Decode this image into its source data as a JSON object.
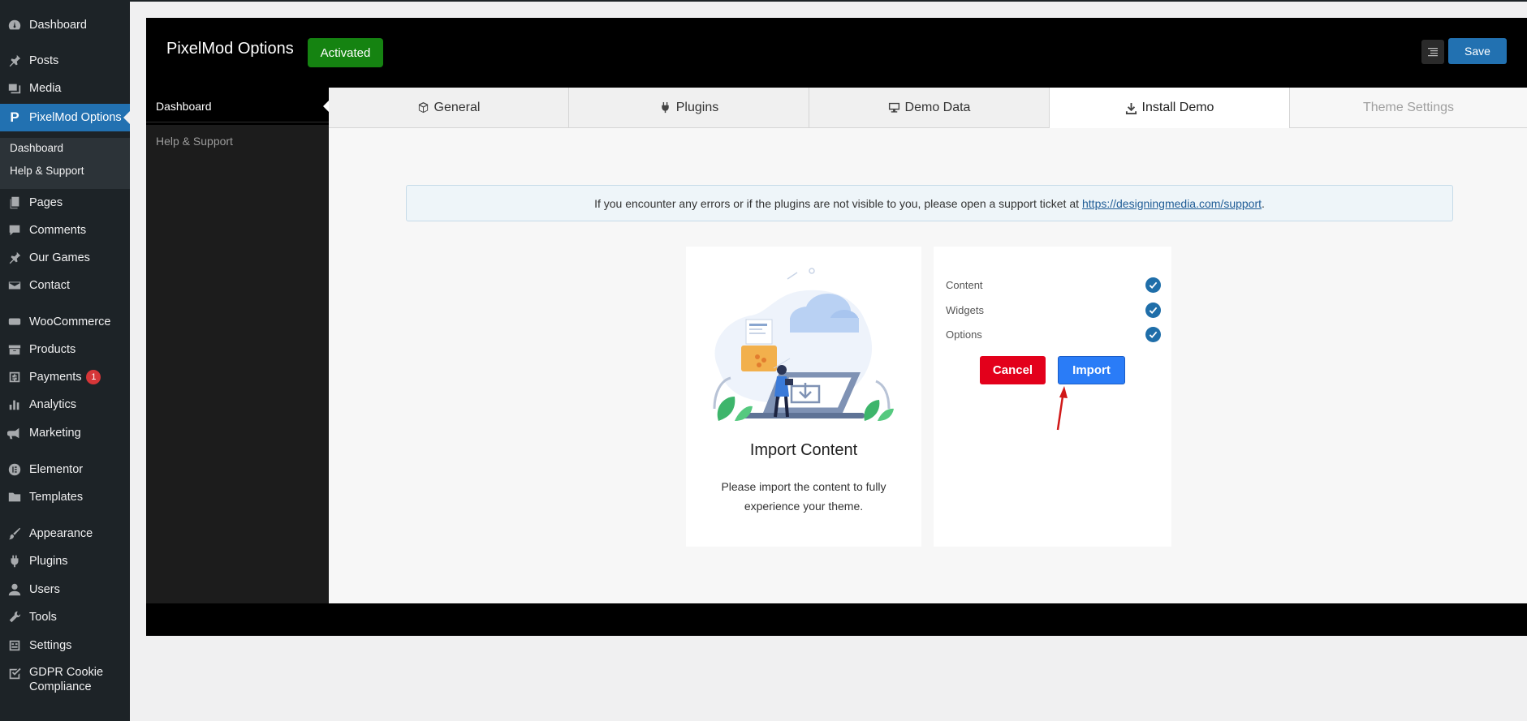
{
  "wp_menu": {
    "dashboard": "Dashboard",
    "posts": "Posts",
    "media": "Media",
    "pixelmod": "PixelMod Options",
    "sub_dashboard": "Dashboard",
    "sub_help": "Help & Support",
    "pages": "Pages",
    "comments": "Comments",
    "our_games": "Our Games",
    "contact": "Contact",
    "woocommerce": "WooCommerce",
    "products": "Products",
    "payments": "Payments",
    "payments_badge": "1",
    "analytics": "Analytics",
    "marketing": "Marketing",
    "elementor": "Elementor",
    "templates": "Templates",
    "appearance": "Appearance",
    "plugins": "Plugins",
    "users": "Users",
    "tools": "Tools",
    "settings": "Settings",
    "gdpr_line1": "GDPR Cookie",
    "gdpr_line2": "Compliance"
  },
  "panel": {
    "title": "PixelMod Options",
    "status": "Activated",
    "save_label": "Save",
    "side": {
      "dashboard": "Dashboard",
      "help": "Help & Support"
    },
    "tabs": {
      "general": "General",
      "plugins": "Plugins",
      "demo_data": "Demo Data",
      "install_demo": "Install Demo",
      "theme_settings": "Theme Settings"
    },
    "notice": {
      "text": "If you encounter any errors or if the plugins are not visible to you, please open a support ticket at",
      "link": "https://designingmedia.com/support",
      "suffix": "."
    },
    "import_card": {
      "title": "Import Content",
      "desc": "Please import the content to fully experience your theme."
    },
    "options": {
      "content": "Content",
      "widgets": "Widgets",
      "options": "Options"
    },
    "cancel_label": "Cancel",
    "import_label": "Import"
  },
  "colors": {
    "wp_sidebar": "#1d2327",
    "wp_accent": "#2271b1",
    "activated_green": "#158311",
    "cancel_red": "#e3001b",
    "import_blue": "#2a7cf7",
    "check_blue": "#1f6ea9"
  }
}
